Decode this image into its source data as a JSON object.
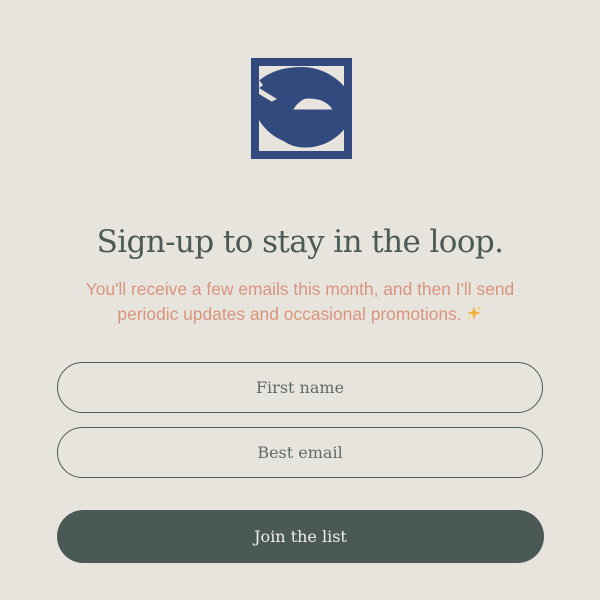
{
  "brand": {
    "logo_icon": "loop-logo-icon",
    "logo_color": "#334a7f"
  },
  "signup": {
    "title": "Sign-up to stay in the loop.",
    "subtitle_line1": "You'll receive a few emails this month, and then I'll send",
    "subtitle_line2": "periodic updates and occasional promotions.",
    "sparkle_icon": "sparkles-icon",
    "first_name_placeholder": "First name",
    "first_name_value": "",
    "email_placeholder": "Best email",
    "email_value": "",
    "submit_label": "Join the list"
  },
  "colors": {
    "background": "#e7e3dd",
    "heading": "#4b5a56",
    "subtitle": "#d9957c",
    "button": "#4a5955",
    "button_text": "#f1eee9"
  }
}
